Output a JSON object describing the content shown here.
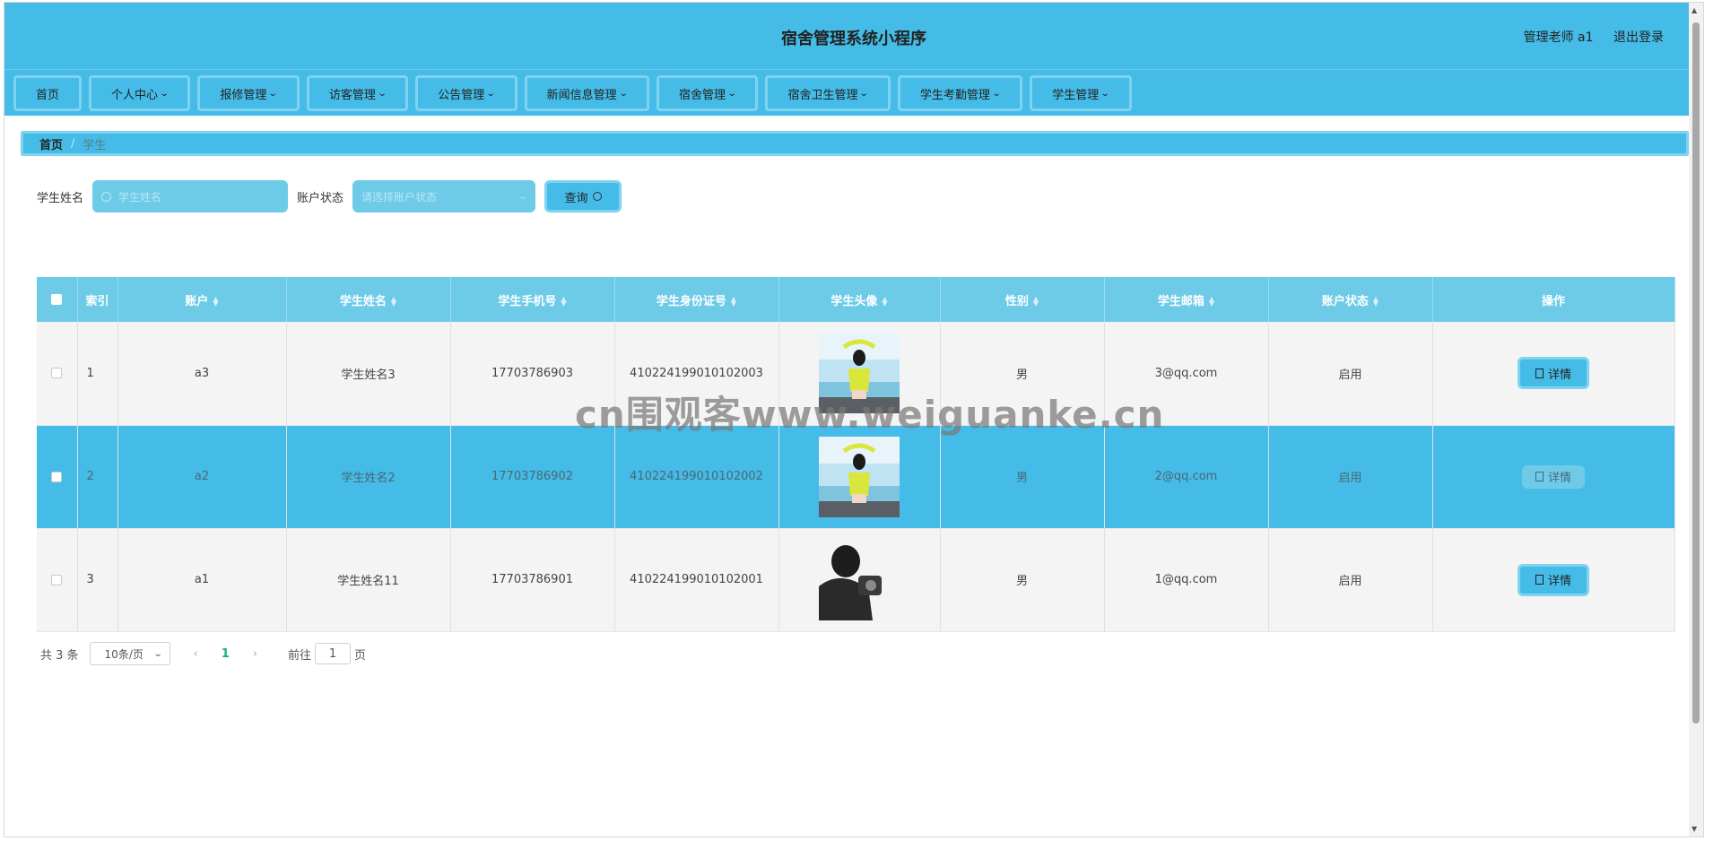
{
  "app": {
    "title": "宿舍管理系统小程序",
    "user_label": "管理老师 a1",
    "logout_label": "退出登录"
  },
  "nav": [
    {
      "label": "首页",
      "has_dropdown": false
    },
    {
      "label": "个人中心",
      "has_dropdown": true
    },
    {
      "label": "报修管理",
      "has_dropdown": true
    },
    {
      "label": "访客管理",
      "has_dropdown": true
    },
    {
      "label": "公告管理",
      "has_dropdown": true
    },
    {
      "label": "新闻信息管理",
      "has_dropdown": true
    },
    {
      "label": "宿舍管理",
      "has_dropdown": true
    },
    {
      "label": "宿舍卫生管理",
      "has_dropdown": true
    },
    {
      "label": "学生考勤管理",
      "has_dropdown": true
    },
    {
      "label": "学生管理",
      "has_dropdown": true
    }
  ],
  "breadcrumb": {
    "home": "首页",
    "separator": "/",
    "current": "学生"
  },
  "search": {
    "name_label": "学生姓名",
    "name_placeholder": "学生姓名",
    "state_label": "账户状态",
    "state_placeholder": "请选择账户状态",
    "query_label": "查询"
  },
  "table": {
    "headers": [
      "索引",
      "账户",
      "学生姓名",
      "学生手机号",
      "学生身份证号",
      "学生头像",
      "性别",
      "学生邮箱",
      "账户状态",
      "操作"
    ],
    "detail_label": "详情",
    "rows": [
      {
        "index": "1",
        "account": "a3",
        "name": "学生姓名3",
        "phone": "17703786903",
        "id_number": "410224199010102003",
        "avatar": "girl-yellow-photo",
        "gender": "男",
        "email": "3@qq.com",
        "state": "启用"
      },
      {
        "index": "2",
        "account": "a2",
        "name": "学生姓名2",
        "phone": "17703786902",
        "id_number": "410224199010102002",
        "avatar": "girl-yellow-photo",
        "gender": "男",
        "email": "2@qq.com",
        "state": "启用"
      },
      {
        "index": "3",
        "account": "a1",
        "name": "学生姓名11",
        "phone": "17703786901",
        "id_number": "410224199010102001",
        "avatar": "man-camera-photo",
        "gender": "男",
        "email": "1@qq.com",
        "state": "启用"
      }
    ]
  },
  "pagination": {
    "total_text": "共 3 条",
    "page_size": "10条/页",
    "current_page": "1",
    "goto_prefix": "前往",
    "goto_value": "1",
    "goto_suffix": "页"
  },
  "watermark": "cn围观客www.weiguanke.cn",
  "colors": {
    "primary": "#44bce7",
    "light": "#6ecbe8",
    "border": "#7fd3f1",
    "active_page": "#1aae6f"
  }
}
